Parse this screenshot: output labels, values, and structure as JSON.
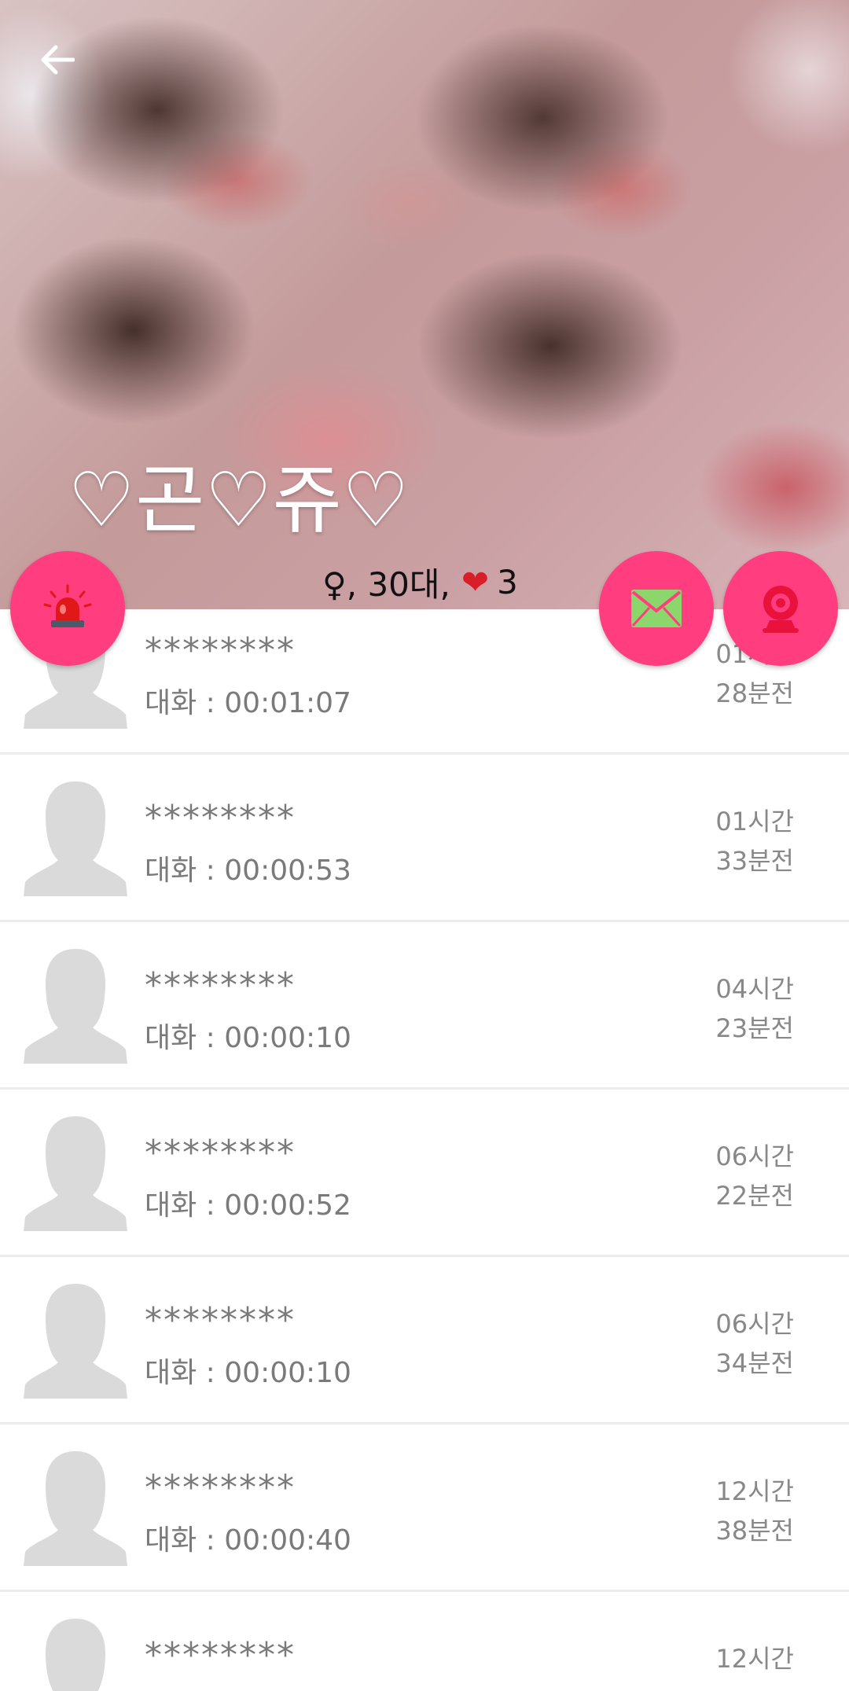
{
  "profile": {
    "name": "♡곤♡쥬♡",
    "gender_age": "♀, 30대,",
    "heart_icon": "❤",
    "heart_count": "3"
  },
  "icons": {
    "back": "arrow-left-icon",
    "report": "siren-icon",
    "message": "envelope-icon",
    "video": "webcam-icon"
  },
  "colors": {
    "accent": "#ff3d7f",
    "envelope": "#8bd76b",
    "webcam": "#e8123c",
    "siren": "#e01818",
    "avatar": "#dadada"
  },
  "calls": [
    {
      "name": "********",
      "duration": "대화 : 00:01:07",
      "time_line1": "01시간",
      "time_line2": "28분전"
    },
    {
      "name": "********",
      "duration": "대화 : 00:00:53",
      "time_line1": "01시간",
      "time_line2": "33분전"
    },
    {
      "name": "********",
      "duration": "대화 : 00:00:10",
      "time_line1": "04시간",
      "time_line2": "23분전"
    },
    {
      "name": "********",
      "duration": "대화 : 00:00:52",
      "time_line1": "06시간",
      "time_line2": "22분전"
    },
    {
      "name": "********",
      "duration": "대화 : 00:00:10",
      "time_line1": "06시간",
      "time_line2": "34분전"
    },
    {
      "name": "********",
      "duration": "대화 : 00:00:40",
      "time_line1": "12시간",
      "time_line2": "38분전"
    },
    {
      "name": "********",
      "duration": "",
      "time_line1": "12시간",
      "time_line2": ""
    }
  ]
}
